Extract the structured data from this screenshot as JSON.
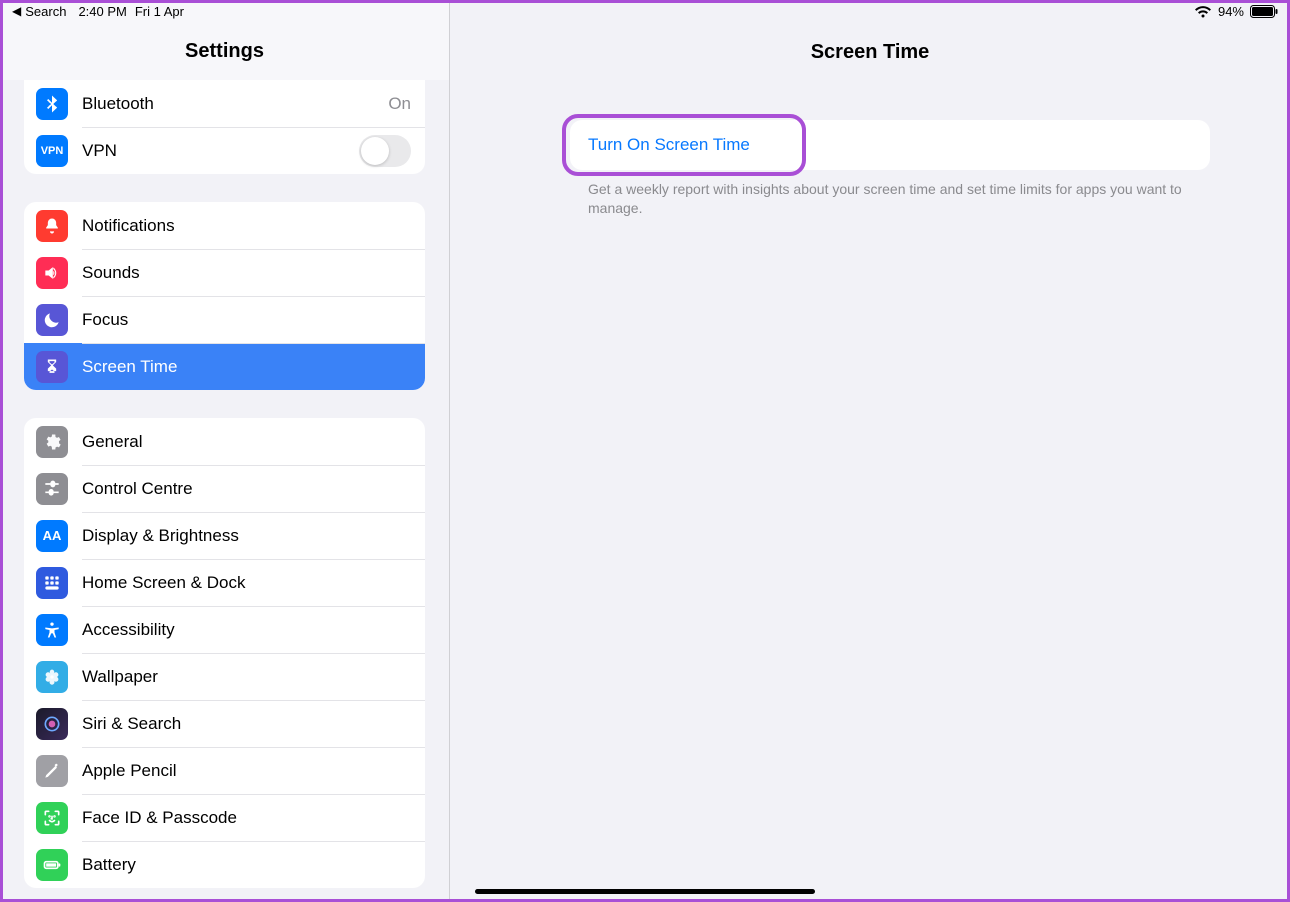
{
  "status_bar": {
    "back_label": "Search",
    "time": "2:40 PM",
    "date": "Fri 1 Apr",
    "battery_pct": "94%"
  },
  "sidebar": {
    "title": "Settings",
    "section1": {
      "bluetooth": {
        "label": "Bluetooth",
        "value": "On"
      },
      "vpn": {
        "label": "VPN"
      }
    },
    "section2": {
      "notifications": {
        "label": "Notifications"
      },
      "sounds": {
        "label": "Sounds"
      },
      "focus": {
        "label": "Focus"
      },
      "screen_time": {
        "label": "Screen Time"
      }
    },
    "section3": {
      "general": {
        "label": "General"
      },
      "control": {
        "label": "Control Centre"
      },
      "display": {
        "label": "Display & Brightness"
      },
      "home": {
        "label": "Home Screen & Dock"
      },
      "access": {
        "label": "Accessibility"
      },
      "wallpaper": {
        "label": "Wallpaper"
      },
      "siri": {
        "label": "Siri & Search"
      },
      "pencil": {
        "label": "Apple Pencil"
      },
      "faceid": {
        "label": "Face ID & Passcode"
      },
      "battery": {
        "label": "Battery"
      }
    }
  },
  "detail": {
    "title": "Screen Time",
    "action_label": "Turn On Screen Time",
    "footer": "Get a weekly report with insights about your screen time and set time limits for apps you want to manage."
  }
}
